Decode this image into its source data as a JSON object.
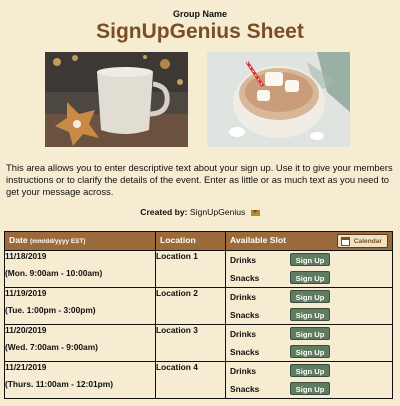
{
  "header": {
    "group_name": "Group Name",
    "title": "SignUpGenius Sheet"
  },
  "images": [
    {
      "name": "cup-with-cookie-photo"
    },
    {
      "name": "hot-cocoa-marshmallows-photo"
    }
  ],
  "description": "This area allows you to enter descriptive text about your sign up. Use it to give your members instructions or to clarify the details of the event. Enter as little or as much text as you need to get your message across.",
  "created_by": {
    "label": "Created by:",
    "name": "SignUpGenius",
    "icon": "envelope-icon"
  },
  "table": {
    "columns": {
      "date": "Date",
      "date_format": "(mm/dd/yyyy EST)",
      "location": "Location",
      "slot": "Available Slot",
      "calendar_button": "Calendar"
    },
    "signup_label": "Sign Up",
    "rows": [
      {
        "date": "11/18/2019",
        "time": "(Mon. 9:00am - 10:00am)",
        "location": "Location 1",
        "slots": [
          "Drinks",
          "Snacks"
        ]
      },
      {
        "date": "11/19/2019",
        "time": "(Tue. 1:00pm - 3:00pm)",
        "location": "Location 2",
        "slots": [
          "Drinks",
          "Snacks"
        ]
      },
      {
        "date": "11/20/2019",
        "time": "(Wed. 7:00am - 9:00am)",
        "location": "Location 3",
        "slots": [
          "Drinks",
          "Snacks"
        ]
      },
      {
        "date": "11/21/2019",
        "time": "(Thurs. 11:00am - 12:01pm)",
        "location": "Location 4",
        "slots": [
          "Drinks",
          "Snacks"
        ]
      }
    ]
  },
  "colors": {
    "background": "#f5ecd2",
    "title": "#7a4f24",
    "table_header": "#9b6a3a",
    "signup_button": "#5f7b60"
  }
}
